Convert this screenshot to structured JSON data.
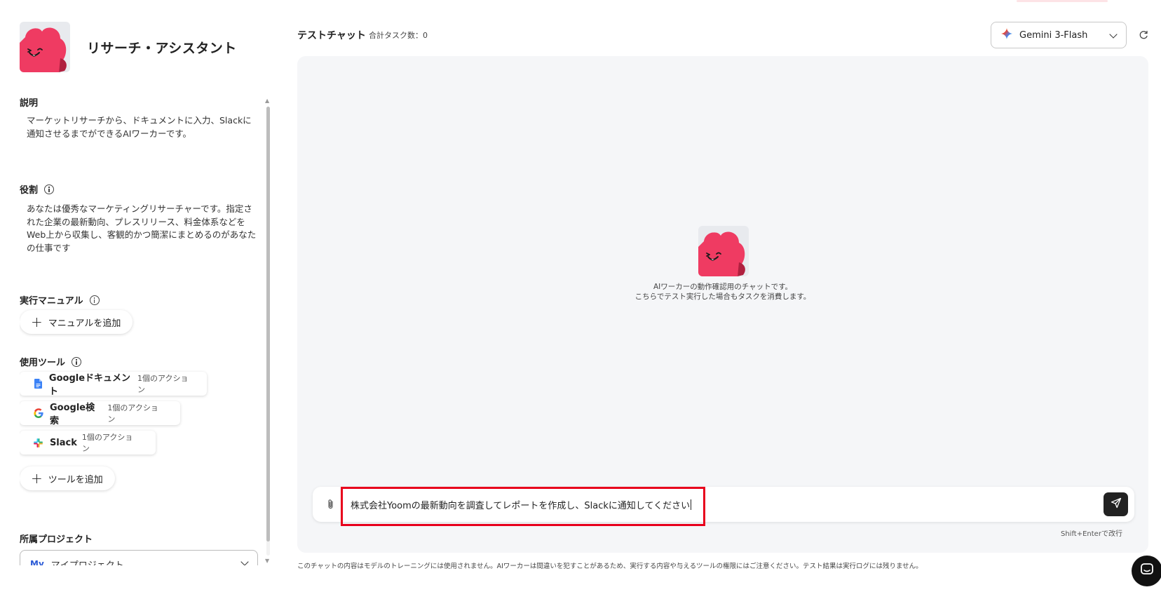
{
  "agent": {
    "name": "リサーチ・アシスタント"
  },
  "sidebar": {
    "description": {
      "title": "説明",
      "text": "マーケットリサーチから、ドキュメントに入力、Slackに通知させるまでができるAIワーカーです。"
    },
    "role": {
      "title": "役割",
      "text": "あなたは優秀なマーケティングリサーチャーです。指定された企業の最新動向、プレスリリース、料金体系などをWeb上から収集し、客観的かつ簡潔にまとめるのがあなたの仕事です"
    },
    "manual": {
      "title": "実行マニュアル",
      "add_label": "マニュアルを追加"
    },
    "tools": {
      "title": "使用ツール",
      "items": [
        {
          "name": "Googleドキュメント",
          "count": "1個のアクション",
          "icon": "google-docs-icon"
        },
        {
          "name": "Google検索",
          "count": "1個のアクション",
          "icon": "google-icon"
        },
        {
          "name": "Slack",
          "count": "1個のアクション",
          "icon": "slack-icon"
        }
      ],
      "add_label": "ツールを追加"
    },
    "project": {
      "title": "所属プロジェクト",
      "badge": "My",
      "value": "マイプロジェクト"
    }
  },
  "header": {
    "chat_title": "テストチャット",
    "task_count": "合計タスク数：0",
    "model": "Gemini 3-Flash"
  },
  "chat": {
    "intro_line1": "AIワーカーの動作確認用のチャットです。",
    "intro_line2": "こちらでテスト実行した場合もタスクを消費します。",
    "input_value": "株式会社Yoomの最新動向を調査してレポートを作成し、Slackに通知してください",
    "shift_hint": "Shift+Enterで改行",
    "disclaimer": "このチャットの内容はモデルのトレーニングには使用されません。AIワーカーは間違いを犯すことがあるため、実行する内容や与えるツールの権限にはご注意ください。テスト結果は実行ログには残りません。"
  },
  "colors": {
    "brand_pink": "#ef3b62",
    "highlight_red": "#e8001c",
    "panel_bg": "#f5f6f8"
  }
}
